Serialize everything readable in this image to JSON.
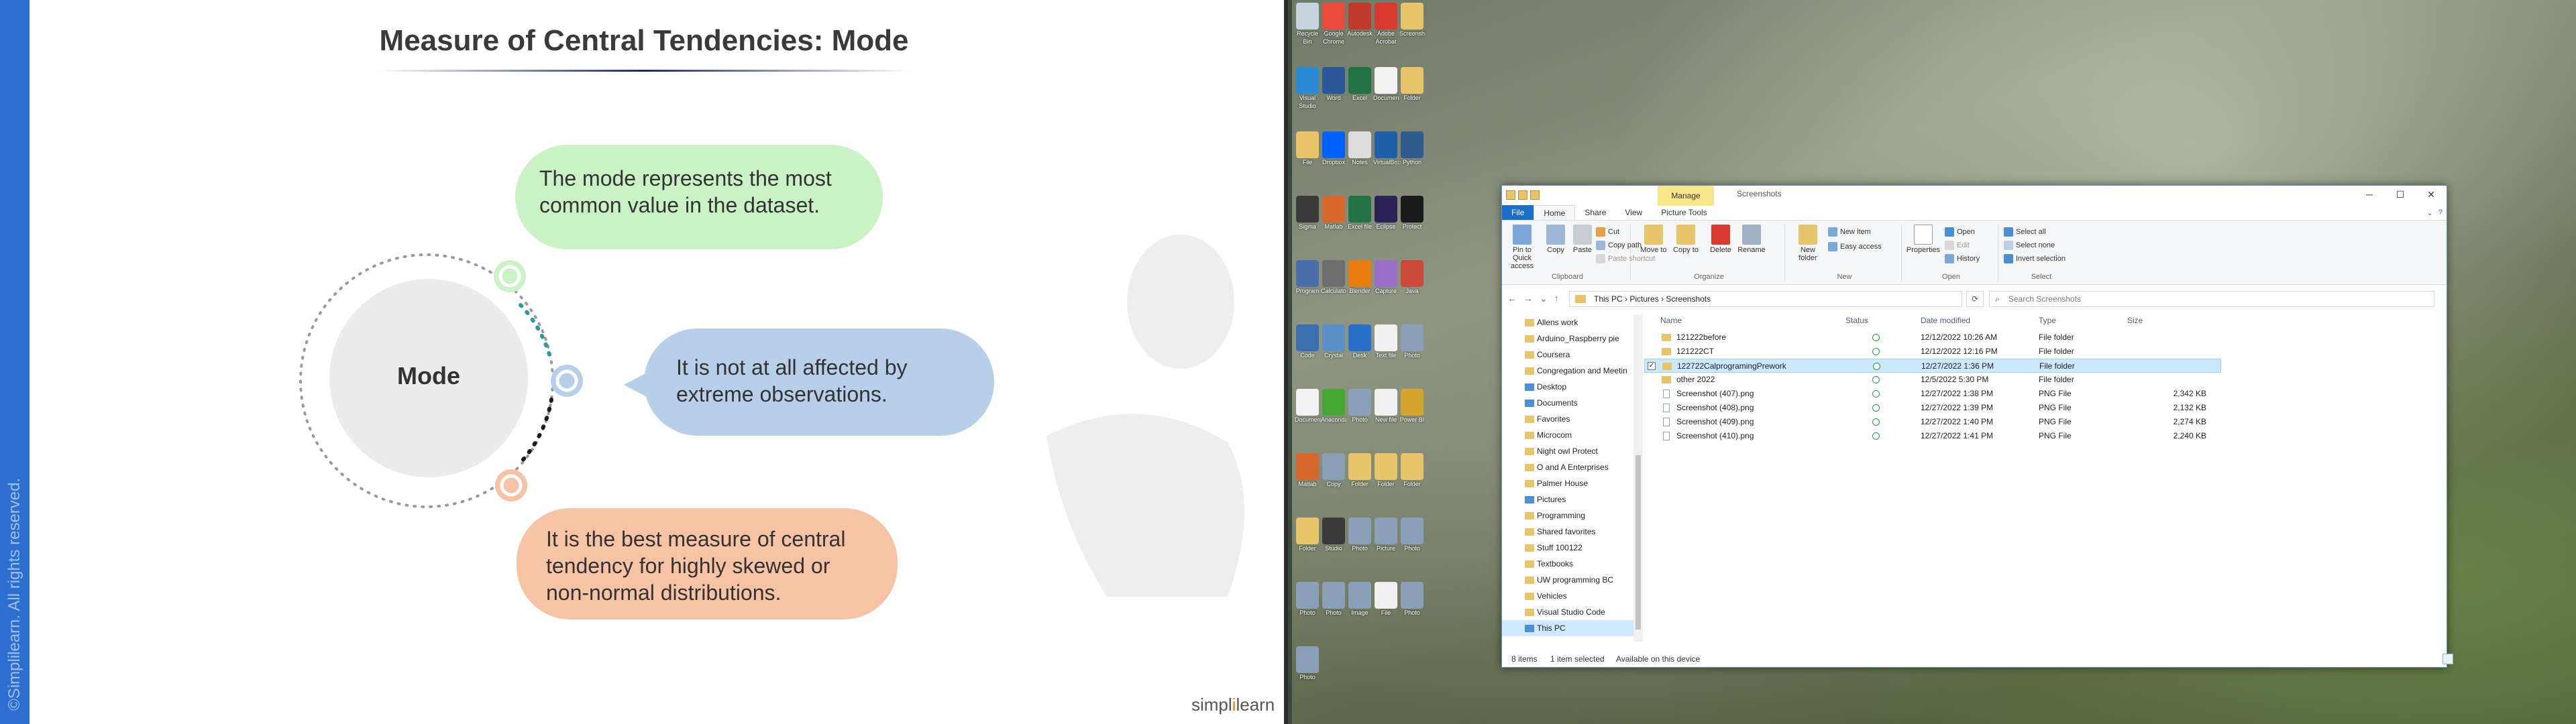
{
  "slide": {
    "title": "Measure of Central Tendencies: Mode",
    "center_label": "Mode",
    "bubble_top": "The mode represents the most common value in the dataset.",
    "bubble_middle": "It is not at all affected by extreme observations.",
    "bubble_bottom": "It is the best measure of central tendency for highly skewed or non-normal distributions.",
    "copyright": "©Simplilearn. All rights reserved.",
    "brand_left": "simpl",
    "brand_accent": "i",
    "brand_right": "learn",
    "colors": {
      "sidebar": "#2d6fd0",
      "bubble_green": "#c9f2c5",
      "bubble_blue": "#b7cfe9",
      "bubble_orange": "#f6c3a5",
      "underline_red": "#e0281e"
    }
  },
  "desktop": {
    "icons": [
      {
        "label": "Recycle Bin",
        "icon": "recycle-bin-icon",
        "color": "#c7d3dc"
      },
      {
        "label": "Google Chrome",
        "icon": "chrome-icon",
        "color": "#e94b3c"
      },
      {
        "label": "Autodesk",
        "icon": "autodesk-icon",
        "color": "#c0392b"
      },
      {
        "label": "Adobe Acrobat",
        "icon": "acrobat-icon",
        "color": "#d83b2d"
      },
      {
        "label": "Screenshots",
        "icon": "folder-icon",
        "color": "#e8c46a"
      },
      {
        "label": "Visual Studio Code",
        "icon": "vscode-icon",
        "color": "#2a8ad4"
      },
      {
        "label": "Word",
        "icon": "word-icon",
        "color": "#2b579a"
      },
      {
        "label": "Excel",
        "icon": "excel-icon",
        "color": "#217346"
      },
      {
        "label": "Document",
        "icon": "document-icon",
        "color": "#f2f2f2"
      },
      {
        "label": "Folder",
        "icon": "folder-icon",
        "color": "#e8c46a"
      },
      {
        "label": "File",
        "icon": "file-icon",
        "color": "#e8c46a"
      },
      {
        "label": "Dropbox",
        "icon": "dropbox-icon",
        "color": "#0061fe"
      },
      {
        "label": "Notes",
        "icon": "notes-icon",
        "color": "#dddddd"
      },
      {
        "label": "VirtualBox",
        "icon": "virtualbox-icon",
        "color": "#1f5fa8"
      },
      {
        "label": "Python",
        "icon": "python-icon",
        "color": "#2f5c8a"
      },
      {
        "label": "Sigma",
        "icon": "sigma-icon",
        "color": "#3a3a3a"
      },
      {
        "label": "Matlab",
        "icon": "matlab-icon",
        "color": "#d9682c"
      },
      {
        "label": "Excel file",
        "icon": "excel-icon",
        "color": "#217346"
      },
      {
        "label": "Eclipse",
        "icon": "eclipse-icon",
        "color": "#2c2255"
      },
      {
        "label": "Protect",
        "icon": "protect-icon",
        "color": "#1b1b1b"
      },
      {
        "label": "Program",
        "icon": "program-icon",
        "color": "#4a6fa8"
      },
      {
        "label": "Calculator",
        "icon": "calculator-icon",
        "color": "#6e6e6e"
      },
      {
        "label": "Blender",
        "icon": "blender-icon",
        "color": "#e87d0d"
      },
      {
        "label": "Capture",
        "icon": "capture-icon",
        "color": "#9a6fc7"
      },
      {
        "label": "Java",
        "icon": "java-icon",
        "color": "#c94a3a"
      },
      {
        "label": "Code",
        "icon": "code-icon",
        "color": "#3a6fb0"
      },
      {
        "label": "Crystal",
        "icon": "crystal-icon",
        "color": "#5a8fc7"
      },
      {
        "label": "Desk",
        "icon": "desk-icon",
        "color": "#2a6fc7"
      },
      {
        "label": "Text file",
        "icon": "file-icon",
        "color": "#f0f0f0"
      },
      {
        "label": "Photo",
        "icon": "image-icon",
        "color": "#8aa0b8"
      },
      {
        "label": "Document",
        "icon": "document-icon",
        "color": "#f2f2f2"
      },
      {
        "label": "Anaconda",
        "icon": "anaconda-icon",
        "color": "#44a833"
      },
      {
        "label": "Photo",
        "icon": "image-icon",
        "color": "#8aa0b8"
      },
      {
        "label": "New file",
        "icon": "file-icon",
        "color": "#f0f0f0"
      },
      {
        "label": "Power BI",
        "icon": "powerbi-icon",
        "color": "#d4a72c"
      },
      {
        "label": "Matlab",
        "icon": "matlab-icon",
        "color": "#d9682c"
      },
      {
        "label": "Copy",
        "icon": "image-icon",
        "color": "#8aa0b8"
      },
      {
        "label": "Folder",
        "icon": "folder-icon",
        "color": "#e8c46a"
      },
      {
        "label": "Folder",
        "icon": "folder-icon",
        "color": "#e8c46a"
      },
      {
        "label": "Folder",
        "icon": "folder-icon",
        "color": "#e8c46a"
      },
      {
        "label": "Folder",
        "icon": "folder-icon",
        "color": "#e8c46a"
      },
      {
        "label": "Studio",
        "icon": "studio-icon",
        "color": "#3a3a3a"
      },
      {
        "label": "Photo",
        "icon": "image-icon",
        "color": "#8aa0b8"
      },
      {
        "label": "Picture",
        "icon": "image-icon",
        "color": "#8aa0b8"
      },
      {
        "label": "Photo",
        "icon": "image-icon",
        "color": "#8aa0b8"
      },
      {
        "label": "Photo",
        "icon": "image-icon",
        "color": "#8aa0b8"
      },
      {
        "label": "Photo",
        "icon": "image-icon",
        "color": "#8aa0b8"
      },
      {
        "label": "Image",
        "icon": "image-icon",
        "color": "#8aa0b8"
      },
      {
        "label": "File",
        "icon": "file-icon",
        "color": "#f0f0f0"
      },
      {
        "label": "Photo",
        "icon": "image-icon",
        "color": "#8aa0b8"
      },
      {
        "label": "Photo",
        "icon": "image-icon",
        "color": "#8aa0b8"
      }
    ]
  },
  "explorer": {
    "window_title": "Screenshots",
    "manage_tab": "Manage",
    "tabs": {
      "file": "File",
      "home": "Home",
      "share": "Share",
      "view": "View",
      "picture_tools": "Picture Tools"
    },
    "ribbon": {
      "pin": "Pin to Quick access",
      "copy": "Copy",
      "paste": "Paste",
      "cut": "Cut",
      "copy_path": "Copy path",
      "paste_shortcut": "Paste shortcut",
      "clipboard_group": "Clipboard",
      "move_to": "Move to",
      "copy_to": "Copy to",
      "delete": "Delete",
      "rename": "Rename",
      "organize_group": "Organize",
      "new_folder": "New folder",
      "new_item": "New item",
      "easy_access": "Easy access",
      "new_group": "New",
      "properties": "Properties",
      "open": "Open",
      "edit": "Edit",
      "history": "History",
      "open_group": "Open",
      "select_all": "Select all",
      "select_none": "Select none",
      "invert_selection": "Invert selection",
      "select_group": "Select"
    },
    "address": {
      "parts": [
        "This PC",
        "Pictures",
        "Screenshots"
      ],
      "this_pc": "This PC",
      "sep1": "›",
      "pictures": "Pictures",
      "sep2": "›",
      "screenshots": "Screenshots",
      "search_placeholder": "Search Screenshots"
    },
    "nav_items": [
      {
        "label": "Allens work"
      },
      {
        "label": "Arduino_Raspberry pie"
      },
      {
        "label": "Coursera"
      },
      {
        "label": "Congregation and Meetin"
      },
      {
        "label": "Desktop",
        "special": true
      },
      {
        "label": "Documents",
        "special": true
      },
      {
        "label": "Favorites"
      },
      {
        "label": "Microcom"
      },
      {
        "label": "Night owl Protect"
      },
      {
        "label": "O and A Enterprises"
      },
      {
        "label": "Palmer House"
      },
      {
        "label": "Pictures",
        "special": true
      },
      {
        "label": "Programming"
      },
      {
        "label": "Shared favorites"
      },
      {
        "label": "Stuff 100122"
      },
      {
        "label": "Textbooks"
      },
      {
        "label": "UW programming BC"
      },
      {
        "label": "Vehicles"
      },
      {
        "label": "Visual Studio Code"
      },
      {
        "label": "This PC",
        "special": true,
        "selected": true
      }
    ],
    "columns": {
      "name": "Name",
      "status": "Status",
      "date": "Date modified",
      "type": "Type",
      "size": "Size"
    },
    "files": [
      {
        "name": "121222before",
        "date": "12/12/2022 10:26 AM",
        "type": "File folder",
        "size": "",
        "kind": "folder"
      },
      {
        "name": "121222CT",
        "date": "12/12/2022 12:16 PM",
        "type": "File folder",
        "size": "",
        "kind": "folder"
      },
      {
        "name": "122722CalprogramingPrework",
        "date": "12/27/2022 1:36 PM",
        "type": "File folder",
        "size": "",
        "kind": "folder",
        "selected": true
      },
      {
        "name": "other 2022",
        "date": "12/5/2022 5:30 PM",
        "type": "File folder",
        "size": "",
        "kind": "folder"
      },
      {
        "name": "Screenshot (407).png",
        "date": "12/27/2022 1:38 PM",
        "type": "PNG File",
        "size": "2,342 KB",
        "kind": "png"
      },
      {
        "name": "Screenshot (408).png",
        "date": "12/27/2022 1:39 PM",
        "type": "PNG File",
        "size": "2,132 KB",
        "kind": "png"
      },
      {
        "name": "Screenshot (409).png",
        "date": "12/27/2022 1:40 PM",
        "type": "PNG File",
        "size": "2,274 KB",
        "kind": "png"
      },
      {
        "name": "Screenshot (410).png",
        "date": "12/27/2022 1:41 PM",
        "type": "PNG File",
        "size": "2,240 KB",
        "kind": "png"
      }
    ],
    "status": {
      "items": "8 items",
      "selected": "1 item selected",
      "available": "Available on this device"
    }
  }
}
